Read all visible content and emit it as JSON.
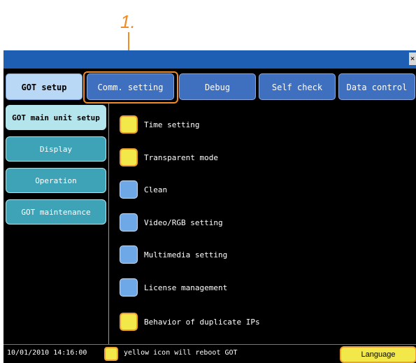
{
  "callout": {
    "number": "1."
  },
  "titlebar": {
    "close_glyph": "×"
  },
  "tabs": [
    {
      "label": "GOT setup"
    },
    {
      "label": "Comm. setting"
    },
    {
      "label": "Debug"
    },
    {
      "label": "Self check"
    },
    {
      "label": "Data control"
    }
  ],
  "sidebar": {
    "items": [
      {
        "label": "GOT main unit setup"
      },
      {
        "label": "Display"
      },
      {
        "label": "Operation"
      },
      {
        "label": "GOT maintenance"
      }
    ]
  },
  "menu": {
    "items": [
      {
        "label": "Time setting",
        "icon": "yellow"
      },
      {
        "label": "Transparent mode",
        "icon": "yellow"
      },
      {
        "label": "Clean",
        "icon": "blue"
      },
      {
        "label": "Video/RGB setting",
        "icon": "blue"
      },
      {
        "label": "Multimedia setting",
        "icon": "blue"
      },
      {
        "label": "License management",
        "icon": "blue"
      },
      {
        "label": "Behavior of duplicate IPs",
        "icon": "yellow"
      }
    ]
  },
  "statusbar": {
    "datetime": "10/01/2010 14:16:00",
    "legend": "yellow icon will reboot GOT",
    "language_button": "Language"
  },
  "colors": {
    "accent_orange": "#f08c28",
    "titlebar_blue": "#1f5fb3",
    "tab_blue": "#3f6fbf",
    "tab_active": "#b8d8f5",
    "sidebar_teal": "#3fa3b8",
    "sidebar_active": "#b5e5ec",
    "icon_yellow": "#f2e84a",
    "icon_blue": "#6fa8e6"
  }
}
